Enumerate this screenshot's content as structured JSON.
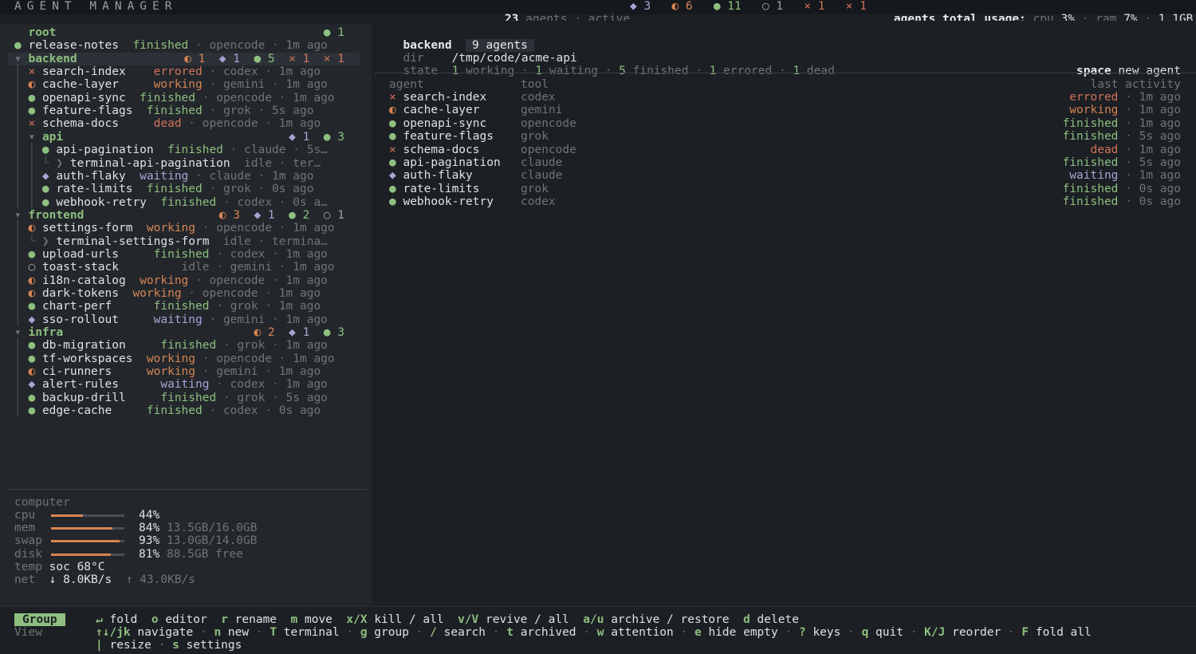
{
  "app": {
    "title": "AGENT MANAGER"
  },
  "topbar": {
    "agents_count": "23",
    "agents_label": "agents",
    "active_label": "active",
    "counts": [
      {
        "glyph": "◆",
        "n": "3",
        "cls": "st-waiting"
      },
      {
        "glyph": "◐",
        "n": "6",
        "cls": "st-working"
      },
      {
        "glyph": "●",
        "n": "11",
        "cls": "st-finished"
      },
      {
        "glyph": "○",
        "n": "1",
        "cls": "st-idle-dot"
      },
      {
        "glyph": "×",
        "n": "1",
        "cls": "st-errored"
      },
      {
        "glyph": "×",
        "n": "1",
        "cls": "st-dead"
      }
    ],
    "usage_label": "agents total usage:",
    "cpu_label": "cpu",
    "cpu_value": "3%",
    "ram_label": "ram",
    "ram_value": "7%",
    "ram_mem": "1.1GB"
  },
  "tree": [
    {
      "kind": "group",
      "indent": "",
      "prefix": "  ",
      "name": "root",
      "counts": "● 1"
    },
    {
      "kind": "agent",
      "indent": "",
      "prefix": "● ",
      "prefix_cls": "st-finished",
      "name": "release-notes",
      "pad": "  ",
      "status": "finished",
      "status_cls": "st-finished",
      "tool": "opencode",
      "time": "1m ago"
    },
    {
      "kind": "group",
      "indent": "",
      "prefix": "▾ ",
      "name": "backend",
      "counts": "◐ 1  ◆ 1  ● 5  × 1  × 1",
      "selected": true
    },
    {
      "kind": "agent",
      "indent": "│ ",
      "prefix": "× ",
      "prefix_cls": "st-errored",
      "name": "search-index",
      "pad": "    ",
      "status": "errored",
      "status_cls": "st-errored",
      "tool": "codex",
      "time": "1m ago"
    },
    {
      "kind": "agent",
      "indent": "│ ",
      "prefix": "◐ ",
      "prefix_cls": "st-working",
      "name": "cache-layer",
      "pad": "     ",
      "status": "working",
      "status_cls": "st-working",
      "tool": "gemini",
      "time": "1m ago"
    },
    {
      "kind": "agent",
      "indent": "│ ",
      "prefix": "● ",
      "prefix_cls": "st-finished",
      "name": "openapi-sync",
      "pad": "  ",
      "status": "finished",
      "status_cls": "st-finished",
      "tool": "opencode",
      "time": "1m ago"
    },
    {
      "kind": "agent",
      "indent": "│ ",
      "prefix": "● ",
      "prefix_cls": "st-finished",
      "name": "feature-flags",
      "pad": "  ",
      "status": "finished",
      "status_cls": "st-finished",
      "tool": "grok",
      "time": "5s ago"
    },
    {
      "kind": "agent",
      "indent": "│ ",
      "prefix": "× ",
      "prefix_cls": "st-dead",
      "name": "schema-docs",
      "pad": "     ",
      "status": "dead",
      "status_cls": "st-dead",
      "tool": "opencode",
      "time": "1m ago"
    },
    {
      "kind": "group",
      "indent": "│ ",
      "prefix": "▾ ",
      "name": "api",
      "counts": "◆ 1  ● 3"
    },
    {
      "kind": "agent",
      "indent": "│ │ ",
      "prefix": "● ",
      "prefix_cls": "st-finished",
      "name": "api-pagination",
      "pad": "  ",
      "status": "finished",
      "status_cls": "st-finished",
      "tool": "claude",
      "time": "5s…"
    },
    {
      "kind": "agent",
      "indent": "│ │ └ ",
      "prefix": "❯ ",
      "prefix_cls": "dim",
      "name": "terminal-api-pagination",
      "pad": "  ",
      "status": "idle",
      "status_cls": "st-idle",
      "tool": "ter…",
      "time": ""
    },
    {
      "kind": "agent",
      "indent": "│ │ ",
      "prefix": "◆ ",
      "prefix_cls": "st-waiting",
      "name": "auth-flaky",
      "pad": "  ",
      "status": "waiting",
      "status_cls": "st-waiting",
      "tool": "claude",
      "time": "1m ago"
    },
    {
      "kind": "agent",
      "indent": "│ │ ",
      "prefix": "● ",
      "prefix_cls": "st-finished",
      "name": "rate-limits",
      "pad": "  ",
      "status": "finished",
      "status_cls": "st-finished",
      "tool": "grok",
      "time": "0s ago"
    },
    {
      "kind": "agent",
      "indent": "│ │ ",
      "prefix": "● ",
      "prefix_cls": "st-finished",
      "name": "webhook-retry",
      "pad": "  ",
      "status": "finished",
      "status_cls": "st-finished",
      "tool": "codex",
      "time": "0s a…"
    },
    {
      "kind": "group",
      "indent": "",
      "prefix": "▾ ",
      "name": "frontend",
      "counts": "◐ 3  ◆ 1  ● 2  ○ 1"
    },
    {
      "kind": "agent",
      "indent": "│ ",
      "prefix": "◐ ",
      "prefix_cls": "st-working",
      "name": "settings-form",
      "pad": "  ",
      "status": "working",
      "status_cls": "st-working",
      "tool": "opencode",
      "time": "1m ago"
    },
    {
      "kind": "agent",
      "indent": "│ └ ",
      "prefix": "❯ ",
      "prefix_cls": "dim",
      "name": "terminal-settings-form",
      "pad": "  ",
      "status": "idle",
      "status_cls": "st-idle",
      "tool": "termina…",
      "time": ""
    },
    {
      "kind": "agent",
      "indent": "│ ",
      "prefix": "● ",
      "prefix_cls": "st-finished",
      "name": "upload-urls",
      "pad": "     ",
      "status": "finished",
      "status_cls": "st-finished",
      "tool": "codex",
      "time": "1m ago"
    },
    {
      "kind": "agent",
      "indent": "│ ",
      "prefix": "○ ",
      "prefix_cls": "st-idle-dot",
      "name": "toast-stack",
      "pad": "         ",
      "status": "idle",
      "status_cls": "st-idle",
      "tool": "gemini",
      "time": "1m ago"
    },
    {
      "kind": "agent",
      "indent": "│ ",
      "prefix": "◐ ",
      "prefix_cls": "st-working",
      "name": "i18n-catalog",
      "pad": "  ",
      "status": "working",
      "status_cls": "st-working",
      "tool": "opencode",
      "time": "1m ago"
    },
    {
      "kind": "agent",
      "indent": "│ ",
      "prefix": "◐ ",
      "prefix_cls": "st-working",
      "name": "dark-tokens",
      "pad": "  ",
      "status": "working",
      "status_cls": "st-working",
      "tool": "opencode",
      "time": "1m ago"
    },
    {
      "kind": "agent",
      "indent": "│ ",
      "prefix": "● ",
      "prefix_cls": "st-finished",
      "name": "chart-perf",
      "pad": "      ",
      "status": "finished",
      "status_cls": "st-finished",
      "tool": "grok",
      "time": "1m ago"
    },
    {
      "kind": "agent",
      "indent": "│ ",
      "prefix": "◆ ",
      "prefix_cls": "st-waiting",
      "name": "sso-rollout",
      "pad": "     ",
      "status": "waiting",
      "status_cls": "st-waiting",
      "tool": "gemini",
      "time": "1m ago"
    },
    {
      "kind": "group",
      "indent": "",
      "prefix": "▾ ",
      "name": "infra",
      "counts": "◐ 2  ◆ 1  ● 3"
    },
    {
      "kind": "agent",
      "indent": "│ ",
      "prefix": "● ",
      "prefix_cls": "st-finished",
      "name": "db-migration",
      "pad": "     ",
      "status": "finished",
      "status_cls": "st-finished",
      "tool": "grok",
      "time": "1m ago"
    },
    {
      "kind": "agent",
      "indent": "│ ",
      "prefix": "● ",
      "prefix_cls": "st-finished",
      "name": "tf-workspaces",
      "pad": "  ",
      "status": "working",
      "status_cls": "st-working",
      "tool": "opencode",
      "time": "1m ago"
    },
    {
      "kind": "agent",
      "indent": "│ ",
      "prefix": "◐ ",
      "prefix_cls": "st-working",
      "name": "ci-runners",
      "pad": "     ",
      "status": "working",
      "status_cls": "st-working",
      "tool": "gemini",
      "time": "1m ago"
    },
    {
      "kind": "agent",
      "indent": "│ ",
      "prefix": "◆ ",
      "prefix_cls": "st-waiting",
      "name": "alert-rules",
      "pad": "      ",
      "status": "waiting",
      "status_cls": "st-waiting",
      "tool": "codex",
      "time": "1m ago"
    },
    {
      "kind": "agent",
      "indent": "│ ",
      "prefix": "● ",
      "prefix_cls": "st-finished",
      "name": "backup-drill",
      "pad": "     ",
      "status": "finished",
      "status_cls": "st-finished",
      "tool": "grok",
      "time": "5s ago"
    },
    {
      "kind": "agent",
      "indent": "│ ",
      "prefix": "● ",
      "prefix_cls": "st-finished",
      "name": "edge-cache",
      "pad": "     ",
      "status": "finished",
      "status_cls": "st-finished",
      "tool": "codex",
      "time": "0s ago"
    }
  ],
  "computer": {
    "title": "computer",
    "cpu": {
      "label": "cpu",
      "pct": "44%",
      "frac": 0.44,
      "extra": ""
    },
    "mem": {
      "label": "mem",
      "pct": "84%",
      "frac": 0.84,
      "extra": "13.5GB/16.0GB"
    },
    "swap": {
      "label": "swap",
      "pct": "93%",
      "frac": 0.93,
      "extra": "13.0GB/14.0GB"
    },
    "disk": {
      "label": "disk",
      "pct": "81%",
      "frac": 0.81,
      "extra": "88.5GB free"
    },
    "temp": {
      "label": "temp",
      "value": "soc 68°C"
    },
    "net": {
      "label": "net",
      "down": "↓ 8.0KB/s",
      "up": "↑ 43.0KB/s"
    }
  },
  "detail": {
    "group_name": "backend",
    "agents_badge": "9 agents",
    "dir_label": "dir",
    "dir_value": "/tmp/code/acme-api",
    "state_label": "state",
    "state": [
      {
        "n": "1",
        "label": "working"
      },
      {
        "n": "1",
        "label": "waiting"
      },
      {
        "n": "5",
        "label": "finished"
      },
      {
        "n": "1",
        "label": "errored"
      },
      {
        "n": "1",
        "label": "dead"
      }
    ],
    "new_agent_key": "space",
    "new_agent_label": "new agent",
    "col_agent": "agent",
    "col_tool": "tool",
    "col_activity": "last activity",
    "rows": [
      {
        "glyph": "×",
        "glyph_cls": "st-errored",
        "name": "search-index",
        "tool": "codex",
        "status": "errored",
        "status_cls": "st-errored",
        "time": "1m ago"
      },
      {
        "glyph": "◐",
        "glyph_cls": "st-working",
        "name": "cache-layer",
        "tool": "gemini",
        "status": "working",
        "status_cls": "st-working",
        "time": "1m ago"
      },
      {
        "glyph": "●",
        "glyph_cls": "st-finished",
        "name": "openapi-sync",
        "tool": "opencode",
        "status": "finished",
        "status_cls": "st-finished",
        "time": "1m ago"
      },
      {
        "glyph": "●",
        "glyph_cls": "st-finished",
        "name": "feature-flags",
        "tool": "grok",
        "status": "finished",
        "status_cls": "st-finished",
        "time": "5s ago"
      },
      {
        "glyph": "×",
        "glyph_cls": "st-dead",
        "name": "schema-docs",
        "tool": "opencode",
        "status": "dead",
        "status_cls": "st-dead",
        "time": "1m ago"
      },
      {
        "glyph": "●",
        "glyph_cls": "st-finished",
        "name": "api-pagination",
        "tool": "claude",
        "status": "finished",
        "status_cls": "st-finished",
        "time": "5s ago"
      },
      {
        "glyph": "◆",
        "glyph_cls": "st-waiting",
        "name": "auth-flaky",
        "tool": "claude",
        "status": "waiting",
        "status_cls": "st-waiting",
        "time": "1m ago"
      },
      {
        "glyph": "●",
        "glyph_cls": "st-finished",
        "name": "rate-limits",
        "tool": "grok",
        "status": "finished",
        "status_cls": "st-finished",
        "time": "0s ago"
      },
      {
        "glyph": "●",
        "glyph_cls": "st-finished",
        "name": "webhook-retry",
        "tool": "codex",
        "status": "finished",
        "status_cls": "st-finished",
        "time": "0s ago"
      }
    ]
  },
  "footer": {
    "mode_badge": "Group",
    "view_label": "View",
    "line1": [
      {
        "k": "↵",
        "v": "fold"
      },
      {
        "k": "o",
        "v": "editor"
      },
      {
        "k": "r",
        "v": "rename"
      },
      {
        "k": "m",
        "v": "move"
      },
      {
        "k": "x/X",
        "v": "kill / all"
      },
      {
        "k": "v/V",
        "v": "revive / all"
      },
      {
        "k": "a/u",
        "v": "archive / restore"
      },
      {
        "k": "d",
        "v": "delete"
      }
    ],
    "line2": [
      {
        "k": "↑↓/jk",
        "v": "navigate"
      },
      {
        "k": "n",
        "v": "new"
      },
      {
        "k": "T",
        "v": "terminal"
      },
      {
        "k": "g",
        "v": "group"
      },
      {
        "k": "/",
        "v": "search"
      },
      {
        "k": "t",
        "v": "archived"
      },
      {
        "k": "w",
        "v": "attention"
      },
      {
        "k": "e",
        "v": "hide empty"
      },
      {
        "k": "?",
        "v": "keys"
      },
      {
        "k": "q",
        "v": "quit"
      },
      {
        "k": "K/J",
        "v": "reorder"
      },
      {
        "k": "F",
        "v": "fold all"
      }
    ],
    "line3": [
      {
        "k": "|",
        "v": "resize"
      },
      {
        "k": "s",
        "v": "settings"
      }
    ]
  }
}
